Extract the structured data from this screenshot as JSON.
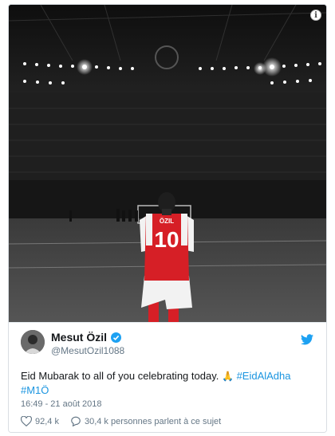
{
  "photo": {
    "jersey_name": "ÖZIL",
    "jersey_number": "10"
  },
  "info_icon": "info-icon",
  "tweet": {
    "author_name": "Mesut Özil",
    "author_handle": "@MesutOzil1088",
    "text_main": "Eid Mubarak to all of you celebrating today.",
    "emoji": "🙏",
    "hashtag1": "#EidAlAdha",
    "hashtag2": "#M1Ö",
    "timestamp": "16:49 - 21 août 2018",
    "likes": "92,4 k",
    "replies_text": "30,4 k personnes parlent à ce sujet"
  },
  "colors": {
    "accent": "#1da1f2",
    "hashtag": "#1b95e0",
    "jersey_red": "#d61f26"
  },
  "icons": [
    "verified-icon",
    "twitter-bird-icon",
    "heart-icon",
    "comment-icon"
  ]
}
